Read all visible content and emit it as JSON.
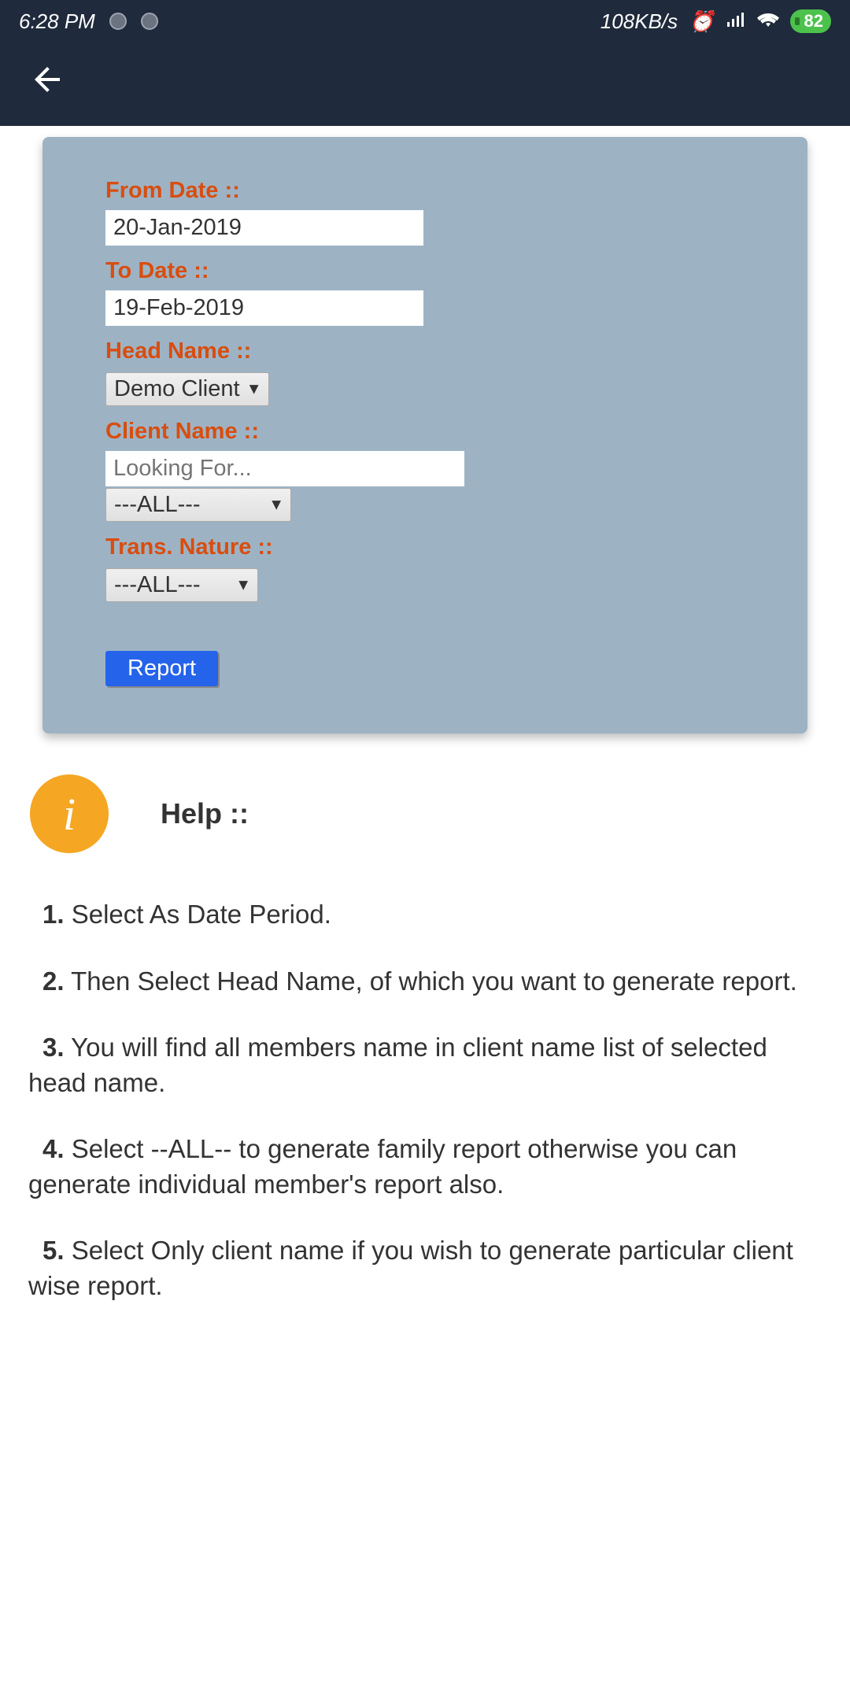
{
  "status": {
    "time": "6:28 PM",
    "speed": "108KB/s",
    "battery": "82"
  },
  "form": {
    "from_date_label": "From Date ::",
    "from_date_value": "20-Jan-2019",
    "to_date_label": "To Date ::",
    "to_date_value": "19-Feb-2019",
    "head_name_label": "Head Name ::",
    "head_name_value": "Demo Client",
    "client_name_label": "Client Name ::",
    "client_name_placeholder": "Looking For...",
    "client_name_select": "---ALL---",
    "trans_nature_label": "Trans. Nature ::",
    "trans_nature_select": "---ALL---",
    "report_button": "Report"
  },
  "help": {
    "title": "Help ::",
    "items": [
      {
        "num": "1.",
        "text": " Select As Date Period."
      },
      {
        "num": "2.",
        "text": " Then Select Head Name, of which you want to generate report."
      },
      {
        "num": "3.",
        "text": " You will find all members name in client name list of selected head name."
      },
      {
        "num": "4.",
        "text": " Select --ALL-- to generate family report otherwise you can generate individual member's report also."
      },
      {
        "num": "5.",
        "text": " Select Only client name if you wish to generate particular client wise report."
      }
    ]
  }
}
